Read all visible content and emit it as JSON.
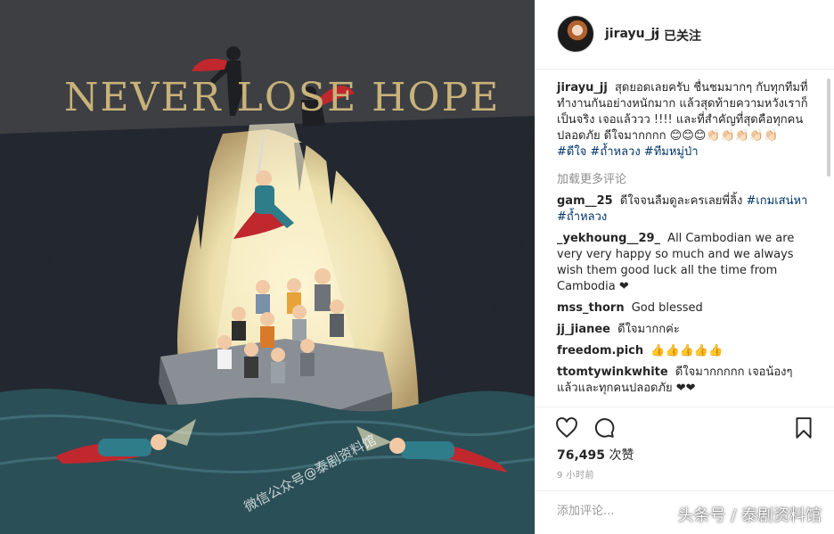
{
  "image": {
    "title": "NEVER LOSE HOPE",
    "watermark": "微信公众号@泰剧资料馆",
    "colors": {
      "sky": "#3d3f43",
      "cave": "#23272f",
      "glow": "#f3e8bd",
      "water": "#2a4f57",
      "title": "#c9b27a"
    }
  },
  "header": {
    "username": "jirayu_jj",
    "separator": "•",
    "follow_label": "已关注"
  },
  "caption": {
    "username": "jirayu_jj",
    "text": "สุดยอดเลยครับ ชื่นชมมากๆ กับทุกทีมที่ทำงานกันอย่างหนักมาก แล้วสุดท้ายความหวังเราก็เป็นจริง เจอแล้ววว !!!! และที่สำคัญที่สุดคือทุกคนปลอดภัย ดีใจมากกกก 😊😊😊👏🏻👏🏻👏🏻👏🏻👏🏻",
    "hashtags": "#ดีใจ #ถ้ำหลวง #ทีมหมู่ป่า"
  },
  "load_more_label": "加载更多评论",
  "comments": [
    {
      "username": "gam__25",
      "text": "ดีใจจนลืมดูละครเลยพี่ลิ้ง",
      "tags": "#เกมเสน่หา #ถ้ำหลวง"
    },
    {
      "username": "_yekhoung__29_",
      "text": "All Cambodian we are very very happy so much and we always wish them good luck all the time from Cambodia ❤",
      "tags": ""
    },
    {
      "username": "mss_thorn",
      "text": "God blessed",
      "tags": ""
    },
    {
      "username": "jj_jianee",
      "text": "ดีใจมากกค่ะ",
      "tags": ""
    },
    {
      "username": "freedom.pich",
      "text": "👍👍👍👍👍",
      "tags": ""
    },
    {
      "username": "ttomtywinkwhite",
      "text": "ดีใจมากกกกก เจอน้องๆแล้วและทุกคนปลอดภัย ❤❤",
      "tags": ""
    }
  ],
  "actions": {
    "like_icon": "heart-icon",
    "comment_icon": "speech-bubble-icon",
    "save_icon": "bookmark-icon"
  },
  "likes": {
    "count": "76,495",
    "label": "次赞"
  },
  "time": "9 小时前",
  "add_comment_placeholder": "添加评论...",
  "page_watermark": "头条号 / 泰剧资料馆"
}
